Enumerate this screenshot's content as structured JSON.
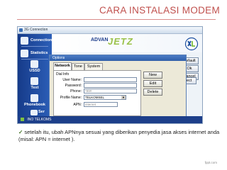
{
  "slide": {
    "title": "CARA INSTALASI MODEM",
    "caption_check": "✓",
    "caption": "setelah itu, ubah APNnya sesuai yang diberikan penyedia jasa akses internet anda (misal: APN = internet ).",
    "footer": "fppt.com"
  },
  "app": {
    "window_title": "3G Connection",
    "sidebar": [
      {
        "label": "Connection",
        "icon": "connection-icon"
      },
      {
        "label": "Statistics",
        "icon": "statistics-icon"
      },
      {
        "label": "USSD",
        "icon": "ussd-icon"
      },
      {
        "label": "Text",
        "icon": "sms-icon"
      },
      {
        "label": "Phonebook",
        "icon": "phonebook-icon"
      },
      {
        "label": "Ser",
        "icon": "settings-icon"
      }
    ],
    "status_text": "INO TELKOMS",
    "brand": {
      "advan": "ADVAN",
      "jetz": "JETZ"
    },
    "side_buttons": {
      "default": "Default",
      "ok": "Ok",
      "cancel": "Cancel"
    },
    "connect_label": "onnect"
  },
  "dialog": {
    "title": "Options",
    "tabs": [
      "Network",
      "Tone",
      "System"
    ],
    "group": "Dial Info",
    "fields": {
      "user_label": "User Name:",
      "user_value": "",
      "password_label": "Password:",
      "password_value": "",
      "phone_label": "Phone:",
      "phone_value": "*99#",
      "profile_label": "Profile Name:",
      "profile_value": "TELKOMSEL",
      "apn_label": "APN:",
      "apn_value": "internet"
    },
    "buttons": {
      "new": "New",
      "edit": "Edit",
      "delete": "Delete"
    }
  },
  "colors": {
    "title": "#c0504d",
    "sidebar": "#1f4b9e",
    "jetz_green": "#9bc24a"
  }
}
